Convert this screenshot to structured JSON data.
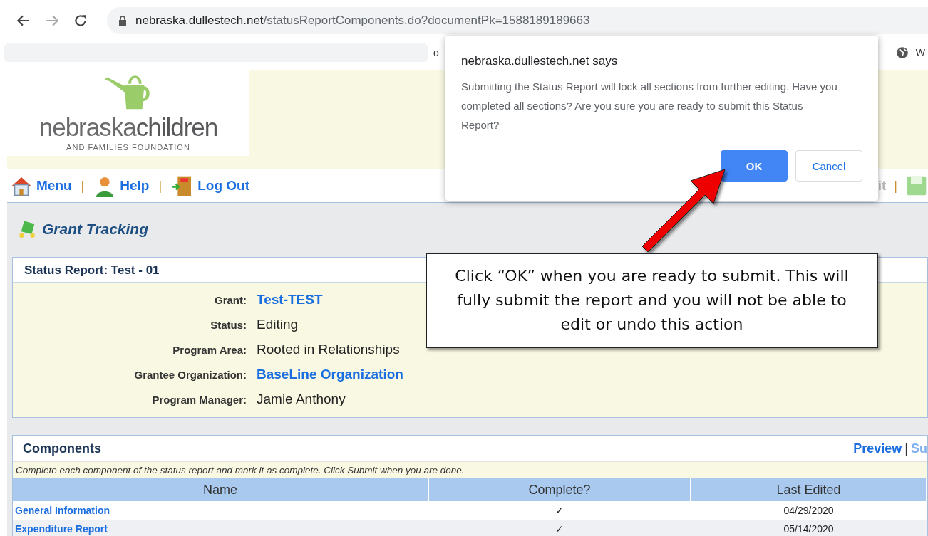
{
  "browser": {
    "url_host": "nebraska.dullestech.net",
    "url_path": "/statusReportComponents.do?documentPk=1588189189663",
    "bookmark_peek": "o",
    "bookmark_right": "W"
  },
  "logo": {
    "text": "nebraska**children**",
    "subtitle": "AND FAMILIES FOUNDATION"
  },
  "nav": [
    {
      "label": "Menu"
    },
    {
      "label": "Help"
    },
    {
      "label": "Log Out"
    }
  ],
  "nav_separator": "|",
  "nav_right_peek": "it",
  "page_title": "Grant Tracking",
  "status_report": {
    "title": "Status Report: Test - 01",
    "fields": [
      {
        "label": "Grant:",
        "value": "Test-TEST",
        "kind": "link"
      },
      {
        "label": "Status:",
        "value": "Editing",
        "kind": "text"
      },
      {
        "label": "Program Area:",
        "value": "Rooted in Relationships",
        "kind": "text"
      },
      {
        "label": "Grantee Organization:",
        "value": "BaseLine Organization",
        "kind": "link"
      },
      {
        "label": "Program Manager:",
        "value": "Jamie Anthony",
        "kind": "text"
      }
    ]
  },
  "components": {
    "title": "Components",
    "actions": [
      "Preview",
      "Su"
    ],
    "action_separator": "|",
    "instruction": "Complete each component of the status report and mark it as complete. Click Submit when you are done.",
    "columns": [
      "Name",
      "Complete?",
      "Last Edited"
    ],
    "rows": [
      {
        "name": "General Information",
        "complete": "✓",
        "last_edited": "04/29/2020"
      },
      {
        "name": "Expenditure Report",
        "complete": "✓",
        "last_edited": "05/14/2020"
      }
    ]
  },
  "dialog": {
    "title": "nebraska.dullestech.net says",
    "message": "Submitting the Status Report will lock all sections from further editing. Have you completed all sections? Are you sure you are ready to submit this Status Report?",
    "buttons": [
      {
        "label": "OK",
        "primary": true
      },
      {
        "label": "Cancel",
        "primary": false
      }
    ]
  },
  "callout": {
    "text": "Click “OK” when you are ready to submit. This will fully submit the report and you will not be able to edit or undo this action"
  }
}
